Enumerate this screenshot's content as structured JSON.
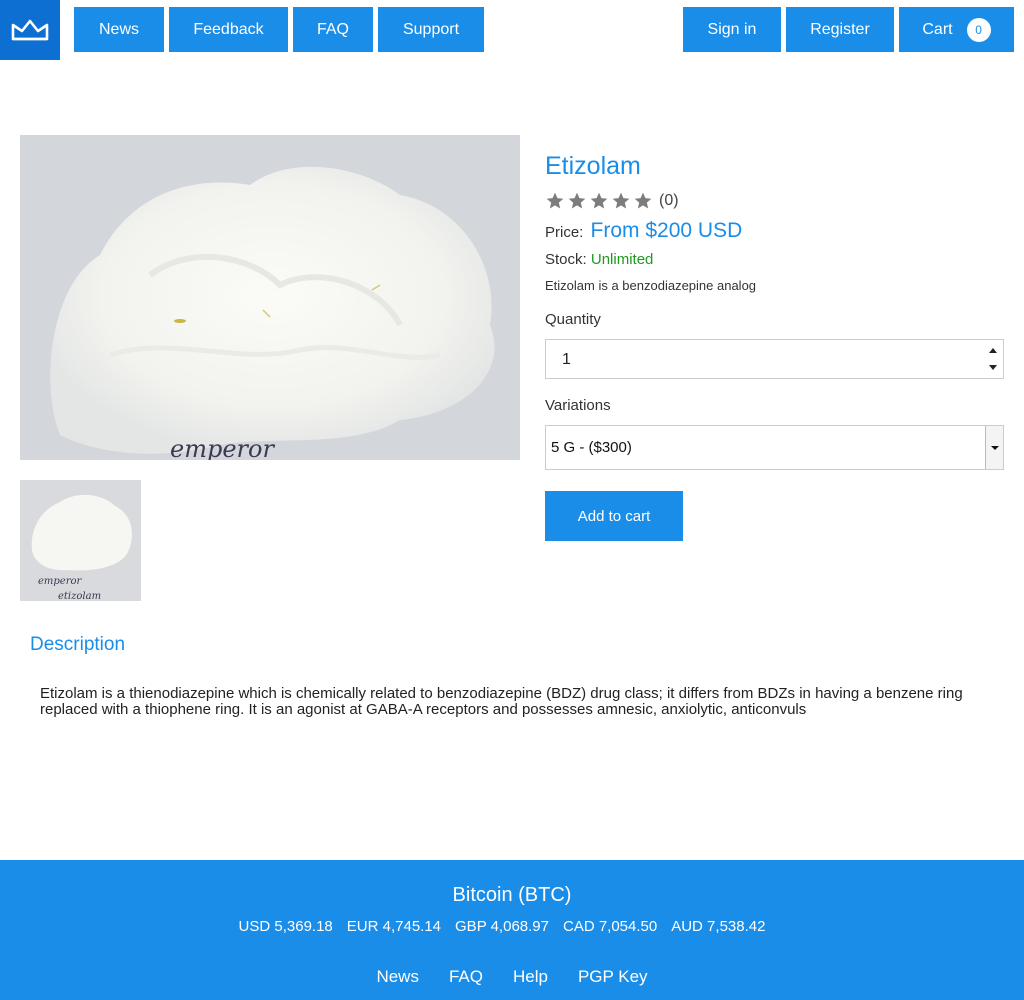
{
  "nav": {
    "left": [
      "News",
      "Feedback",
      "FAQ",
      "Support"
    ],
    "sign_in": "Sign in",
    "register": "Register",
    "cart_label": "Cart",
    "cart_count": "0"
  },
  "product": {
    "image_caption": "emperor",
    "thumb_caption_1": "emperor",
    "thumb_caption_2": "etizolam",
    "title": "Etizolam",
    "rating_count": "(0)",
    "price_label": "Price:",
    "price_value": "From $200 USD",
    "stock_label": "Stock:",
    "stock_value": "Unlimited",
    "short_description": "Etizolam is a benzodiazepine analog",
    "quantity_label": "Quantity",
    "quantity_value": "1",
    "variations_label": "Variations",
    "variation_selected": "5 G - ($300)",
    "add_to_cart": "Add to cart"
  },
  "description": {
    "tab_label": "Description",
    "text": "Etizolam is a thienodiazepine which is chemically related to benzodiazepine (BDZ) drug class; it differs from BDZs in having a benzene ring replaced with a thiophene ring. It is an agonist at GABA-A receptors and possesses amnesic, anxiolytic, anticonvuls"
  },
  "footer": {
    "currency_title": "Bitcoin (BTC)",
    "rates": [
      "USD 5,369.18",
      "EUR 4,745.14",
      "GBP 4,068.97",
      "CAD 7,054.50",
      "AUD 7,538.42"
    ],
    "links": [
      "News",
      "FAQ",
      "Help",
      "PGP Key"
    ]
  },
  "colors": {
    "accent": "#1a8de9",
    "logo_bg": "#0d6fd1",
    "stock_green": "#1f9a1f"
  },
  "icons": {
    "logo": "crown-icon",
    "rating": "star-icon",
    "spinner": "spinner-arrows-icon",
    "dropdown": "chevron-down-icon"
  }
}
